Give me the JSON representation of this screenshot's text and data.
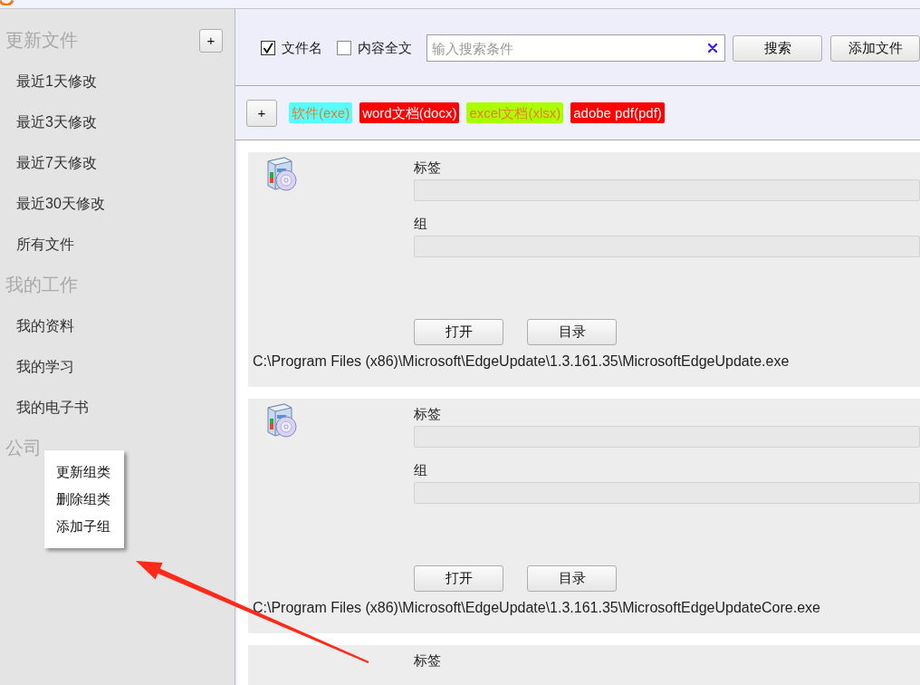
{
  "sidebar": {
    "groups": [
      {
        "title": "更新文件",
        "add_button": "+",
        "items": [
          {
            "label": "最近1天修改",
            "selected": false
          },
          {
            "label": "最近3天修改",
            "selected": false
          },
          {
            "label": "最近7天修改",
            "selected": false
          },
          {
            "label": "最近30天修改",
            "selected": false
          },
          {
            "label": "所有文件",
            "selected": false
          }
        ]
      },
      {
        "title": "我的工作",
        "items": [
          {
            "label": "我的资料",
            "selected": false
          },
          {
            "label": "我的学习",
            "selected": false
          },
          {
            "label": "我的电子书",
            "selected": false
          }
        ]
      },
      {
        "title": "公司"
      }
    ]
  },
  "context_menu": {
    "items": [
      "更新组类",
      "删除组类",
      "添加子组"
    ]
  },
  "search_bar": {
    "options": [
      {
        "label": "文件名",
        "checked": true
      },
      {
        "label": "内容全文",
        "checked": false
      }
    ],
    "placeholder": "输入搜索条件",
    "buttons": [
      "搜索",
      "添加文件"
    ]
  },
  "tag_bar": {
    "add_button": "+",
    "tags": [
      {
        "label": "软件(exe)",
        "color": "#55ffff"
      },
      {
        "label": "word文档(docx)",
        "color": "#ff0000"
      },
      {
        "label": "excel文档(xlsx)",
        "color": "#aaff00"
      },
      {
        "label": "adobe pdf(pdf)",
        "color": "#ff0000"
      }
    ]
  },
  "files": [
    {
      "fields": [
        {
          "label": "标签",
          "disabled": true
        },
        {
          "label": "组",
          "disabled": true
        }
      ],
      "buttons": [
        "打开",
        "目录"
      ],
      "path": "C:\\Program Files (x86)\\Microsoft\\EdgeUpdate\\1.3.161.35\\MicrosoftEdgeUpdate.exe"
    },
    {
      "fields": [
        {
          "label": "标签",
          "disabled": true
        },
        {
          "label": "组",
          "disabled": true
        }
      ],
      "buttons": [
        "打开",
        "目录"
      ],
      "path": "C:\\Program Files (x86)\\Microsoft\\EdgeUpdate\\1.3.161.35\\MicrosoftEdgeUpdateCore.exe"
    },
    {
      "fields": [
        {
          "label": "标签"
        }
      ]
    }
  ]
}
